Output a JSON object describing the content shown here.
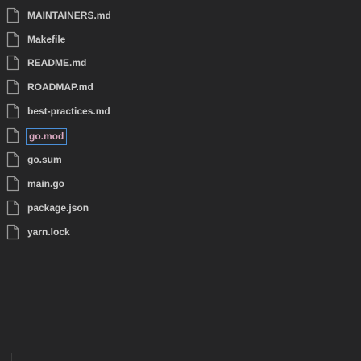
{
  "explorer": {
    "files": [
      {
        "name": "MAINTAINERS.md",
        "icon": "file-icon",
        "selected": false
      },
      {
        "name": "Makefile",
        "icon": "file-icon",
        "selected": false
      },
      {
        "name": "README.md",
        "icon": "file-icon",
        "selected": false
      },
      {
        "name": "ROADMAP.md",
        "icon": "file-icon",
        "selected": false
      },
      {
        "name": "best-practices.md",
        "icon": "file-icon",
        "selected": false
      },
      {
        "name": "go.mod",
        "icon": "file-icon",
        "selected": true
      },
      {
        "name": "go.sum",
        "icon": "file-icon",
        "selected": false
      },
      {
        "name": "main.go",
        "icon": "file-icon",
        "selected": false
      },
      {
        "name": "package.json",
        "icon": "file-icon",
        "selected": false
      },
      {
        "name": "yarn.lock",
        "icon": "file-icon",
        "selected": false
      }
    ]
  },
  "colors": {
    "background": "#252526",
    "text": "#cccccc",
    "icon": "#9a9a9a",
    "selection_border": "#4a8fd8"
  }
}
